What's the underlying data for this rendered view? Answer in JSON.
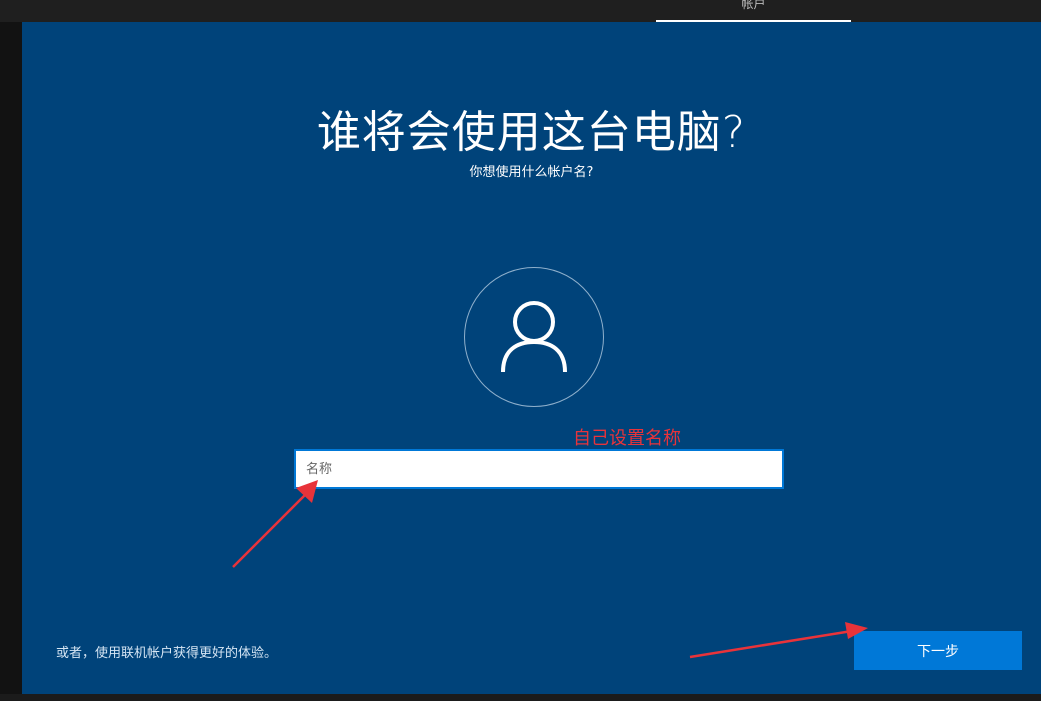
{
  "top_bar": {
    "tab_label": "帐户"
  },
  "page": {
    "title": "谁将会使用这台电脑?",
    "subtitle": "你想使用什么帐户名?"
  },
  "avatar": {
    "icon": "user-icon"
  },
  "annotation": {
    "text": "自己设置名称",
    "color": "#e8333a"
  },
  "name_input": {
    "placeholder": "名称",
    "value": ""
  },
  "footer": {
    "online_account_link": "或者，使用联机帐户获得更好的体验。",
    "next_label": "下一步"
  },
  "colors": {
    "background": "#00437a",
    "accent": "#0078d7",
    "arrow": "#e8333a"
  }
}
